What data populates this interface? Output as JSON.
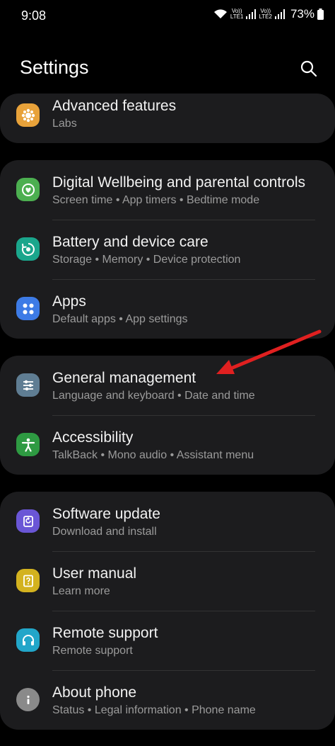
{
  "status": {
    "time": "9:08",
    "sim1": "Vo)) LTE1",
    "sim2": "Vo)) LTE2",
    "battery": "73%"
  },
  "header": {
    "title": "Settings",
    "search_icon": "search-icon"
  },
  "groups": [
    {
      "items": [
        {
          "title": "Advanced features",
          "subtitle": "Labs",
          "icon": "star-gear-icon",
          "color": "#e8a23a"
        }
      ]
    },
    {
      "items": [
        {
          "title": "Digital Wellbeing and parental controls",
          "subtitle": "Screen time  •  App timers  •  Bedtime mode",
          "icon": "wellbeing-icon",
          "color": "#4caf50"
        },
        {
          "title": "Battery and device care",
          "subtitle": "Storage  •  Memory  •  Device protection",
          "icon": "device-care-icon",
          "color": "#1aa68c"
        },
        {
          "title": "Apps",
          "subtitle": "Default apps  •  App settings",
          "icon": "apps-icon",
          "color": "#3d7be6"
        }
      ]
    },
    {
      "items": [
        {
          "title": "General management",
          "subtitle": "Language and keyboard  •  Date and time",
          "icon": "sliders-icon",
          "color": "#5f7d93"
        },
        {
          "title": "Accessibility",
          "subtitle": "TalkBack  •  Mono audio  •  Assistant menu",
          "icon": "accessibility-icon",
          "color": "#2e9a42"
        }
      ]
    },
    {
      "items": [
        {
          "title": "Software update",
          "subtitle": "Download and install",
          "icon": "software-update-icon",
          "color": "#6a56d6"
        },
        {
          "title": "User manual",
          "subtitle": "Learn more",
          "icon": "manual-icon",
          "color": "#d3b21f"
        },
        {
          "title": "Remote support",
          "subtitle": "Remote support",
          "icon": "headset-icon",
          "color": "#22a6c9"
        },
        {
          "title": "About phone",
          "subtitle": "Status  •  Legal information  •  Phone name",
          "icon": "info-icon",
          "color": "#8a8a8a"
        }
      ]
    }
  ],
  "annotation": {
    "arrow_color": "#e02020"
  }
}
